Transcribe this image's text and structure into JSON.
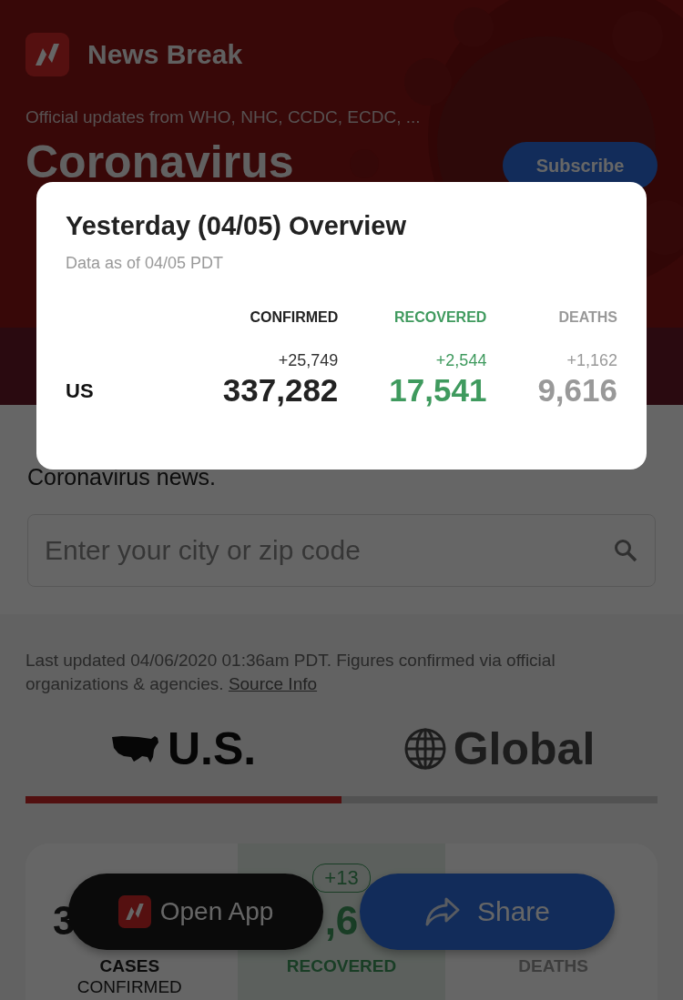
{
  "app": {
    "name": "News Break"
  },
  "header": {
    "subtitle": "Official updates from WHO, NHC, CCDC, ECDC, ...",
    "title": "Coronavirus",
    "subscribe": "Subscribe"
  },
  "intro": {
    "line_2": "Coronavirus news."
  },
  "search": {
    "placeholder": "Enter your city or zip code"
  },
  "updated": {
    "text": "Last updated 04/06/2020 01:36am PDT. Figures confirmed via official organizations & agencies.",
    "link": "Source Info"
  },
  "tabs": [
    {
      "label": "U.S.",
      "selected": true
    },
    {
      "label": "Global",
      "selected": false
    }
  ],
  "cards": [
    {
      "kind": "confirmed",
      "value": "3",
      "label": "CASES",
      "sublabel": "CONFIRMED"
    },
    {
      "kind": "recovered",
      "badge": "+13",
      "value": ",6",
      "label": "RECOVERED"
    },
    {
      "kind": "deaths",
      "label": "DEATHS"
    }
  ],
  "actions": [
    {
      "kind": "open",
      "label": "Open App"
    },
    {
      "kind": "share",
      "label": "Share"
    }
  ],
  "modal": {
    "title": "Yesterday (04/05) Overview",
    "subtitle": "Data as of 04/05 PDT",
    "columns": [
      {
        "kind": "confirmed",
        "label": "CONFIRMED"
      },
      {
        "kind": "recovered",
        "label": "RECOVERED"
      },
      {
        "kind": "deaths",
        "label": "DEATHS"
      }
    ],
    "rows": [
      {
        "region": "US",
        "cells": [
          {
            "change": "+25,749",
            "total": "337,282"
          },
          {
            "change": "+2,544",
            "total": "17,541"
          },
          {
            "change": "+1,162",
            "total": "9,616"
          }
        ]
      }
    ]
  }
}
